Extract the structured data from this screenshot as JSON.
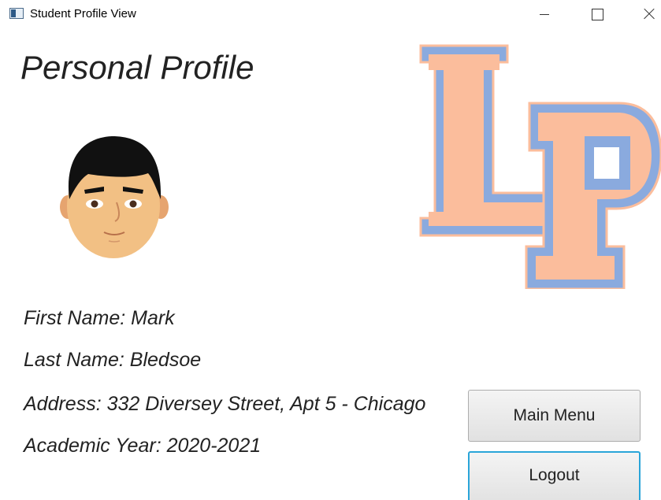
{
  "window": {
    "title": "Student Profile View"
  },
  "page": {
    "title": "Personal Profile"
  },
  "student": {
    "first_name_line": "First Name: Mark",
    "last_name_line": "Last Name: Bledsoe",
    "address_line": "Address: 332 Diversey Street, Apt 5 - Chicago",
    "academic_year_line": "Academic Year: 2020-2021"
  },
  "buttons": {
    "main_menu": "Main Menu",
    "logout": "Logout"
  },
  "icons": {
    "app": "app-window-icon",
    "avatar": "boy-face-icon",
    "logo": "lp-logo"
  },
  "colors": {
    "logo_fill": "#fbbd9c",
    "logo_outline": "#8aaade",
    "focus_border": "#2aa5d9",
    "hair": "#111111",
    "skin": "#f2c084"
  }
}
